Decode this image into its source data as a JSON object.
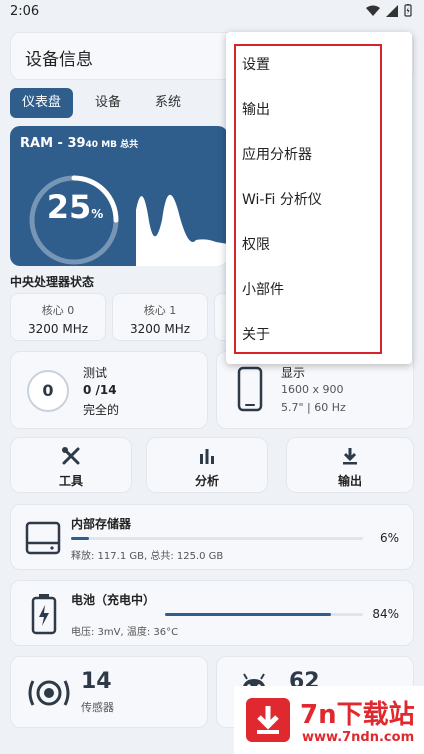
{
  "status": {
    "time": "2:06"
  },
  "header": {
    "title": "设备信息"
  },
  "tabs": [
    {
      "label": "仪表盘",
      "active": true
    },
    {
      "label": "设备",
      "active": false
    },
    {
      "label": "系统",
      "active": false
    }
  ],
  "ram": {
    "label": "RAM - 39",
    "sub": "40 MB 总共",
    "percent": "25",
    "unit": "%",
    "usage_fraction": 0.25
  },
  "cpu": {
    "section_label": "中央处理器状态",
    "cores": [
      {
        "label": "核心 0",
        "freq": "3200 MHz"
      },
      {
        "label": "核心 1",
        "freq": "3200 MHz"
      }
    ]
  },
  "test": {
    "count": "0",
    "title": "测试",
    "progress": "0 /14",
    "status": "完全的"
  },
  "display": {
    "title": "显示",
    "resolution": "1600 x 900",
    "detail": "5.7\" | 60 Hz"
  },
  "actions": [
    {
      "label": "工具",
      "icon": "tools-icon"
    },
    {
      "label": "分析",
      "icon": "bar-chart-icon"
    },
    {
      "label": "输出",
      "icon": "download-icon"
    }
  ],
  "storage": {
    "title": "内部存储器",
    "percent": "6%",
    "fraction": 0.06,
    "detail": "释放: 117.1 GB,  总共: 125.0 GB"
  },
  "battery": {
    "title": "电池（充电中）",
    "percent": "84%",
    "fraction": 0.84,
    "detail": "电压: 3mV,  温度: 36°C"
  },
  "sensors": {
    "count": "14",
    "label": "传感器"
  },
  "apps": {
    "count": "62"
  },
  "menu": {
    "items": [
      "设置",
      "输出",
      "应用分析器",
      "Wi-Fi 分析仪",
      "权限",
      "小部件",
      "关于"
    ]
  },
  "watermark": {
    "brand": "7n下载站",
    "url": "www.7ndn.com"
  },
  "colors": {
    "accent": "#2f5d8c",
    "highlight": "#d7222a",
    "watermark_red": "#e0292f"
  }
}
